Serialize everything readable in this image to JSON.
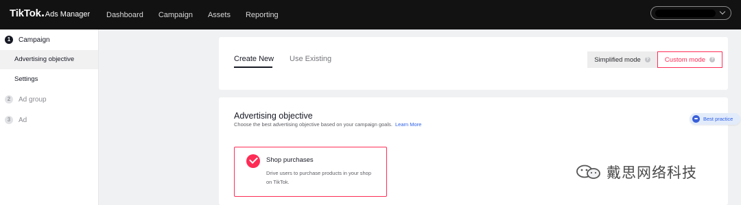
{
  "header": {
    "logo_main": "TikTok",
    "logo_sub": "Ads Manager",
    "nav": [
      "Dashboard",
      "Campaign",
      "Assets",
      "Reporting"
    ]
  },
  "sidebar": {
    "steps": [
      {
        "number": "1",
        "label": "Campaign",
        "active": true
      },
      {
        "number": "2",
        "label": "Ad group",
        "active": false
      },
      {
        "number": "3",
        "label": "Ad",
        "active": false
      }
    ],
    "subitems": [
      {
        "label": "Advertising objective",
        "selected": true
      },
      {
        "label": "Settings",
        "selected": false
      }
    ]
  },
  "tabs": {
    "create_new": "Create New",
    "use_existing": "Use Existing",
    "simplified_mode": "Simplified mode",
    "custom_mode": "Custom mode",
    "help_glyph": "?"
  },
  "objective": {
    "title": "Advertising objective",
    "description": "Choose the best advertising objective based on your campaign goals.",
    "learn_more": "Learn More",
    "best_practice": "Best practice",
    "option": {
      "title": "Shop purchases",
      "description": "Drive users to purchase products in your shop on TikTok."
    }
  },
  "watermark": {
    "text": "戴思网络科技"
  },
  "colors": {
    "accent": "#fe2c55",
    "topbar": "#121212",
    "link": "#2b5ee8"
  }
}
